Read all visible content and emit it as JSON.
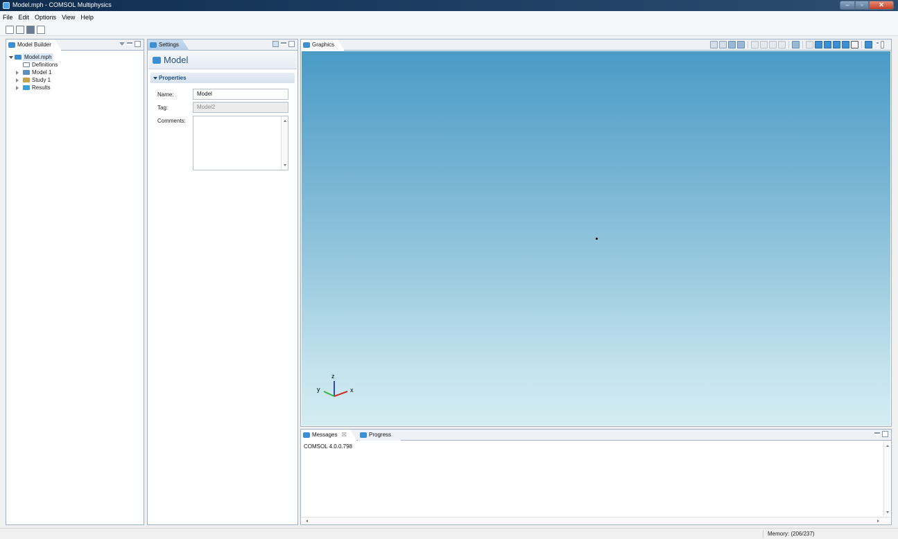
{
  "window": {
    "title": "Model.mph - COMSOL Multiphysics"
  },
  "menu": [
    "File",
    "Edit",
    "Options",
    "View",
    "Help"
  ],
  "toolbar": {
    "icons": [
      "new-icon",
      "open-icon",
      "save-icon",
      "print-icon"
    ]
  },
  "model_builder": {
    "tab_label": "Model Builder",
    "tree": [
      {
        "label": "Model.mph",
        "level": 0,
        "expanded": true,
        "selected": true,
        "icon": "model-icon"
      },
      {
        "label": "Definitions",
        "level": 1,
        "icon": "definitions-icon"
      },
      {
        "label": "Model 1",
        "level": 1,
        "collapsed": true,
        "icon": "3d-model-icon"
      },
      {
        "label": "Study 1",
        "level": 1,
        "collapsed": true,
        "icon": "study-icon"
      },
      {
        "label": "Results",
        "level": 1,
        "collapsed": true,
        "icon": "results-icon"
      }
    ]
  },
  "settings": {
    "tab_label": "Settings",
    "header": "Model",
    "section": "Properties",
    "name_label": "Name:",
    "name_value": "Model",
    "tag_label": "Tag:",
    "tag_value": "Model2",
    "comments_label": "Comments:"
  },
  "graphics": {
    "tab_label": "Graphics",
    "axis_labels": {
      "x": "x",
      "y": "y",
      "z": "z"
    },
    "background_top": "#4a9bc7",
    "background_bottom": "#d3ecf1"
  },
  "messages": {
    "tab_label": "Messages",
    "close_mark": "☒",
    "progress_label": "Progress",
    "text": "COMSOL 4.0.0.798"
  },
  "status": {
    "memory": "Memory: (206/237)"
  }
}
